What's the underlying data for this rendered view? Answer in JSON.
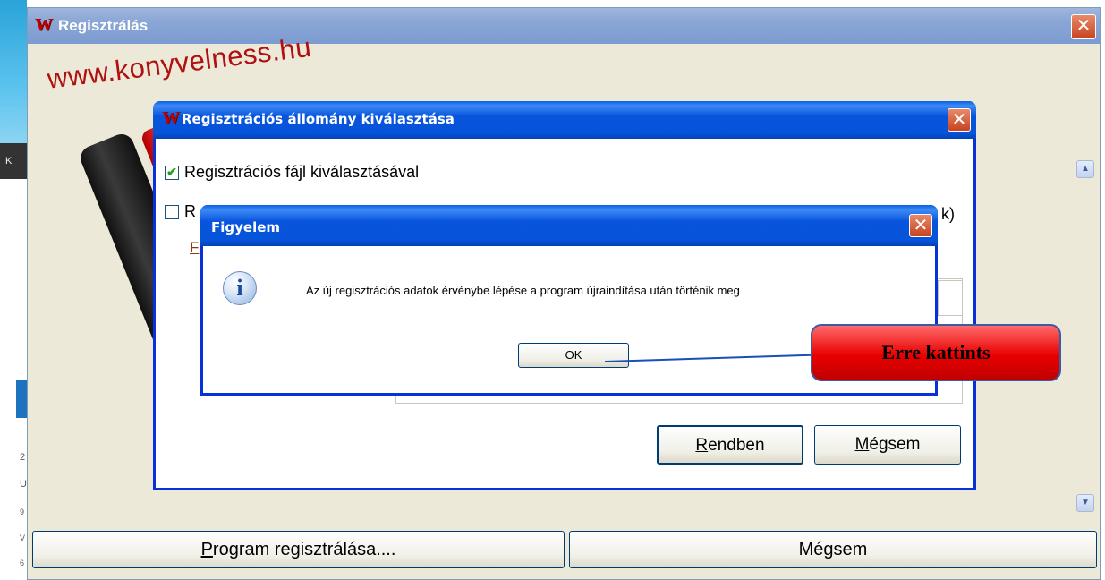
{
  "main_window": {
    "title": "Regisztrálás",
    "watermark": "www.konyvelness.hu",
    "register_button": "Program regisztrálása....",
    "cancel_button": "Mégsem"
  },
  "file_dialog": {
    "title": "Regisztrációs állomány kiválasztása",
    "option_file_label": "Regisztrációs fájl kiválasztásával",
    "option_file_checked": true,
    "option_second_partial_start": "R",
    "option_second_partial_end": "k)",
    "option_second_checked": false,
    "link_partial": "F",
    "ok_button": "Rendben",
    "cancel_button": "Mégsem"
  },
  "alert_dialog": {
    "title": "Figyelem",
    "message": "Az új regisztrációs adatok érvénybe lépése a program újraindítása után történik meg",
    "ok_button": "OK",
    "icon": "info-icon"
  },
  "callout": {
    "text": "Erre kattints",
    "color": "#e80000"
  },
  "background_fragments": {
    "left_chars": [
      "K",
      "I",
      "2",
      "U",
      "9",
      "V",
      "6"
    ]
  }
}
